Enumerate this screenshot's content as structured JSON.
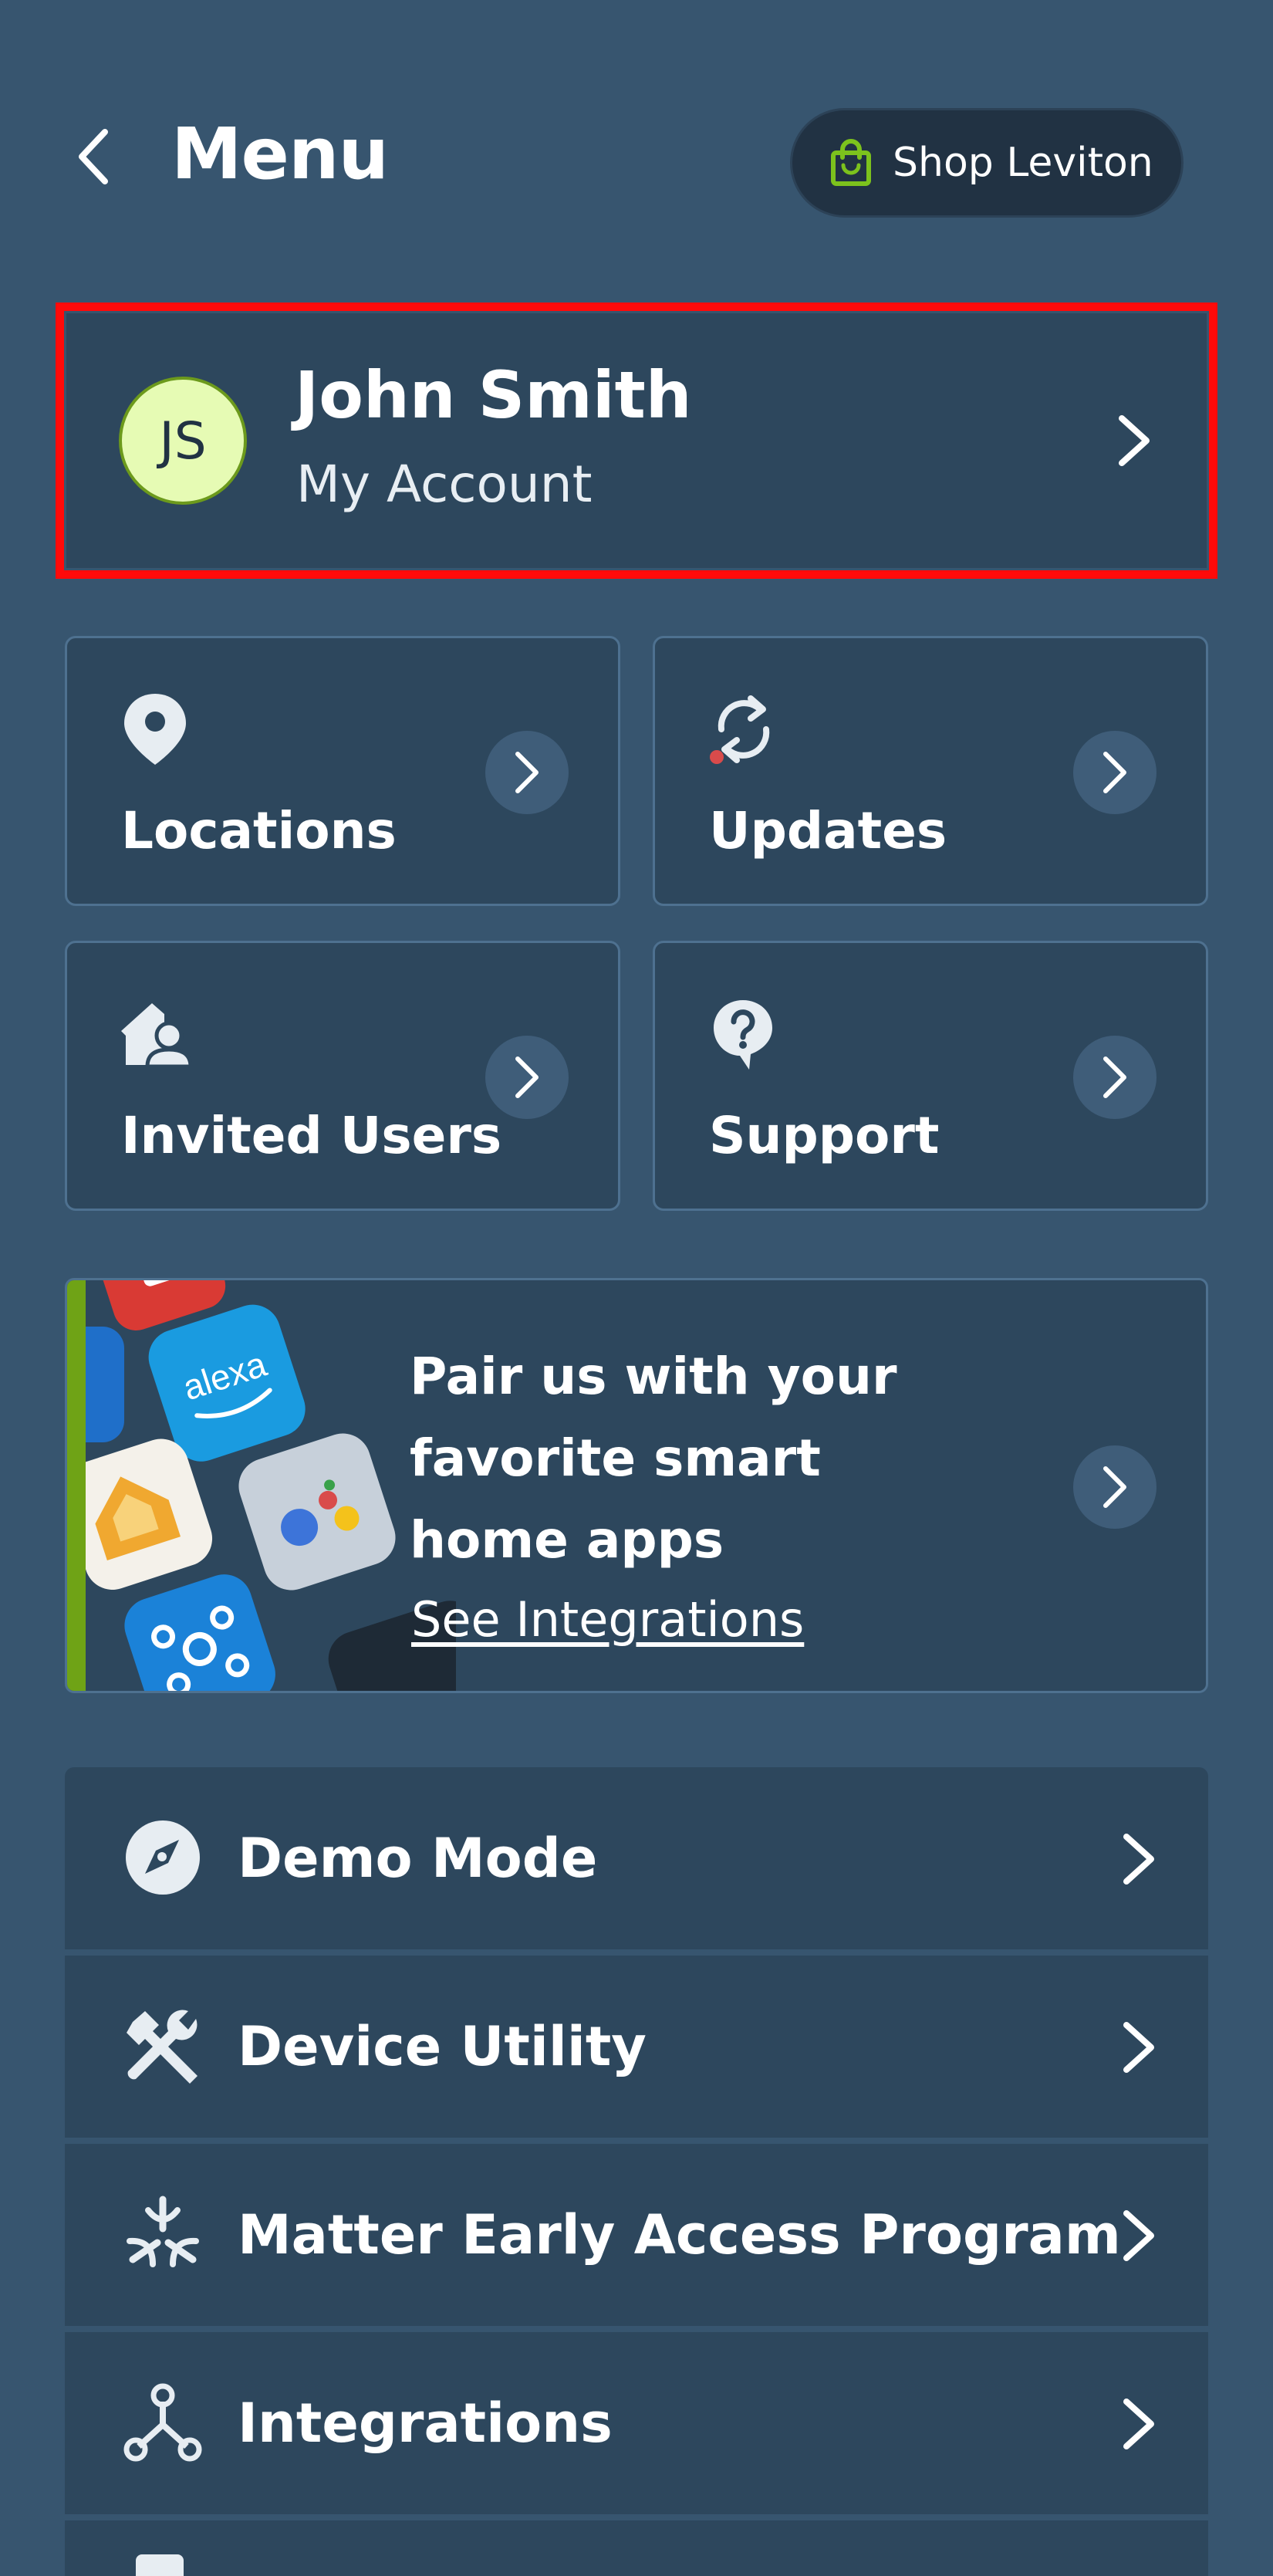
{
  "header": {
    "title": "Menu",
    "back_icon": "chevron-left-icon",
    "shop_label": "Shop Leviton",
    "shop_icon": "shopping-bag-icon"
  },
  "account": {
    "initials": "JS",
    "name": "John Smith",
    "subtitle": "My Account"
  },
  "tiles": [
    {
      "label": "Locations",
      "icon": "location-pin-icon"
    },
    {
      "label": "Updates",
      "icon": "refresh-icon"
    },
    {
      "label": "Invited Users",
      "icon": "house-user-icon"
    },
    {
      "label": "Support",
      "icon": "help-bubble-icon"
    }
  ],
  "banner": {
    "title": "Pair us with your favorite smart home apps",
    "link": "See Integrations",
    "app_badge_alexa": "alexa"
  },
  "menu_items": [
    {
      "label": "Demo Mode",
      "icon": "compass-icon"
    },
    {
      "label": "Device Utility",
      "icon": "tools-icon"
    },
    {
      "label": "Matter Early Access Program",
      "icon": "matter-icon"
    },
    {
      "label": "Integrations",
      "icon": "integrations-icon"
    }
  ],
  "colors": {
    "background": "#37556f",
    "card": "#2d475d",
    "accent_green": "#6fa316",
    "highlight_red": "#ff0a0a",
    "avatar_bg": "#e6fbb4"
  }
}
